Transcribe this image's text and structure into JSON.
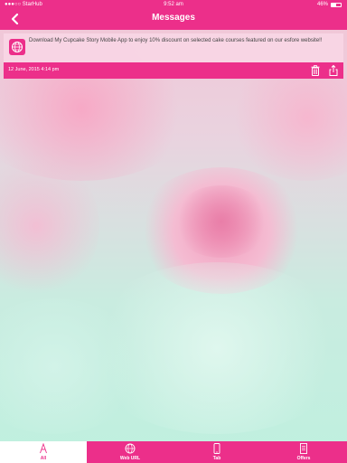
{
  "status_bar": {
    "carrier": "●●●○○ StarHub",
    "time": "9:52 am",
    "battery": "46%"
  },
  "nav": {
    "title": "Messages",
    "back_icon": "chevron-left-icon"
  },
  "message": {
    "text": "Download My Cupcake Story Mobile App to enjoy 10% discount on selected cake courses featured on our esfore website!!",
    "date": "12 June, 2015 4:14 pm",
    "icon": "globe-icon"
  },
  "tabs": [
    {
      "label": "All",
      "icon": "all-icon",
      "active": true
    },
    {
      "label": "Web URL",
      "icon": "globe-icon",
      "active": false
    },
    {
      "label": "Tab",
      "icon": "tablet-icon",
      "active": false
    },
    {
      "label": "Offers",
      "icon": "document-icon",
      "active": false
    }
  ],
  "colors": {
    "accent": "#ec2f8a",
    "card_background": "#f8d6e5"
  }
}
